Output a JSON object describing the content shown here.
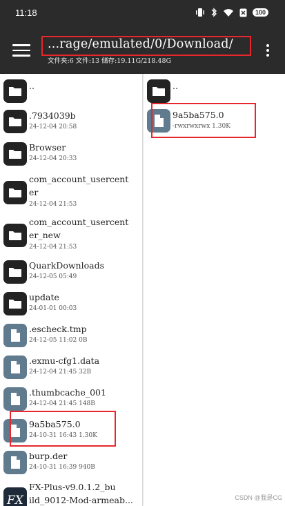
{
  "status_bar": {
    "time": "11:18",
    "battery": "100",
    "icons": [
      "vibrate-icon",
      "bluetooth-icon",
      "wifi-icon",
      "sim-off-icon",
      "battery-icon"
    ]
  },
  "app_bar": {
    "path": "...rage/emulated/0/Download/",
    "stats": "文件夹:6  文件:13  储存:19.11G/218.48G",
    "icons": [
      "menu-icon",
      "more-vert-icon"
    ]
  },
  "left_pane": {
    "items": [
      {
        "name": "..",
        "meta": "",
        "type": "folder"
      },
      {
        "name": ".7934039b",
        "meta": "24-12-04 20:58",
        "type": "folder"
      },
      {
        "name": "Browser",
        "meta": "24-12-04 20:33",
        "type": "folder"
      },
      {
        "name": "com_account_usercenter",
        "name_l1": "com_account_usercent",
        "name_l2": "er",
        "meta": "24-12-04 21:53",
        "type": "folder"
      },
      {
        "name": "com_account_usercenter_new",
        "name_l1": "com_account_usercent",
        "name_l2": "er_new",
        "meta": "24-12-04 21:53",
        "type": "folder"
      },
      {
        "name": "QuarkDownloads",
        "meta": "24-12-05 05:49",
        "type": "folder"
      },
      {
        "name": "update",
        "meta": "24-01-01 00:03",
        "type": "folder"
      },
      {
        "name": ".escheck.tmp",
        "meta": "24-12-05 11:02  0B",
        "type": "file"
      },
      {
        "name": ".exmu-cfg1.data",
        "meta": "24-12-04 21:45  32B",
        "type": "file"
      },
      {
        "name": ".thumbcache_001",
        "meta": "24-12-04 21:45  148B",
        "type": "file"
      },
      {
        "name": "9a5ba575.0",
        "meta": "24-10-31 16:43  1.30K",
        "type": "file"
      },
      {
        "name": "burp.der",
        "meta": "24-10-31 16:39  940B",
        "type": "file"
      },
      {
        "name": "FX-Plus-v9.0.1.2_build_9012-Mod-armeab...",
        "name_l1": "FX-Plus-v9.0.1.2_bu",
        "name_l2": "ild_9012-Mod-armeab...",
        "meta": "",
        "type": "fx"
      }
    ]
  },
  "right_pane": {
    "items": [
      {
        "name": "..",
        "meta": "",
        "type": "folder"
      },
      {
        "name": "9a5ba575.0",
        "meta": "-rwxrwxrwx  1.30K",
        "type": "file"
      }
    ]
  },
  "watermark": "CSDN @我是CG",
  "colors": {
    "bar": "#2b2b2b",
    "highlight": "#e8262b",
    "folder_icon": "#232323",
    "file_icon": "#607a8e"
  }
}
